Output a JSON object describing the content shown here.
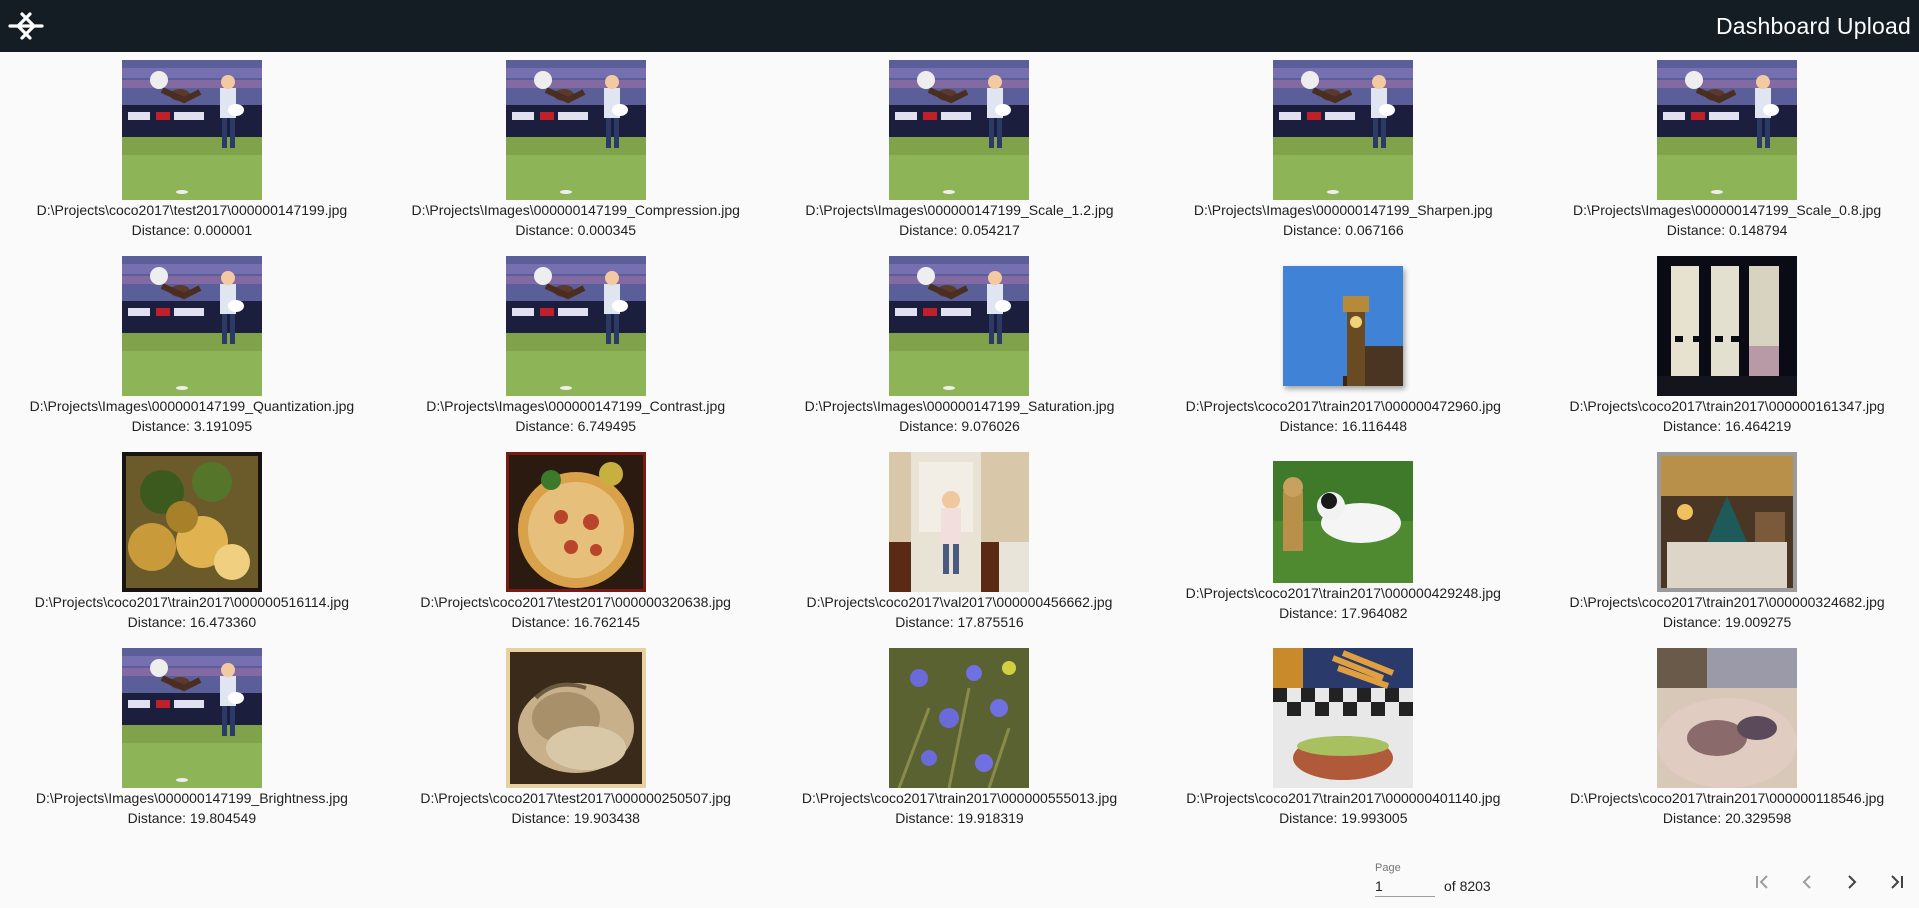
{
  "header": {
    "title": "Dashboard Upload",
    "logo_icon": "logo-icon"
  },
  "results": [
    {
      "path": "D:\\Projects\\coco2017\\test2017\\000000147199.jpg",
      "distance": "Distance: 0.000001",
      "thumb": "frisbee"
    },
    {
      "path": "D:\\Projects\\Images\\000000147199_Compression.jpg",
      "distance": "Distance: 0.000345",
      "thumb": "frisbee"
    },
    {
      "path": "D:\\Projects\\Images\\000000147199_Scale_1.2.jpg",
      "distance": "Distance: 0.054217",
      "thumb": "frisbee"
    },
    {
      "path": "D:\\Projects\\Images\\000000147199_Sharpen.jpg",
      "distance": "Distance: 0.067166",
      "thumb": "frisbee"
    },
    {
      "path": "D:\\Projects\\Images\\000000147199_Scale_0.8.jpg",
      "distance": "Distance: 0.148794",
      "thumb": "frisbee"
    },
    {
      "path": "D:\\Projects\\Images\\000000147199_Quantization.jpg",
      "distance": "Distance: 3.191095",
      "thumb": "frisbee"
    },
    {
      "path": "D:\\Projects\\Images\\000000147199_Contrast.jpg",
      "distance": "Distance: 6.749495",
      "thumb": "frisbee"
    },
    {
      "path": "D:\\Projects\\Images\\000000147199_Saturation.jpg",
      "distance": "Distance: 9.076026",
      "thumb": "frisbee"
    },
    {
      "path": "D:\\Projects\\coco2017\\train2017\\000000472960.jpg",
      "distance": "Distance: 16.116448",
      "thumb": "clocktower"
    },
    {
      "path": "D:\\Projects\\coco2017\\train2017\\000000161347.jpg",
      "distance": "Distance: 16.464219",
      "thumb": "window"
    },
    {
      "path": "D:\\Projects\\coco2017\\train2017\\000000516114.jpg",
      "distance": "Distance: 16.473360",
      "thumb": "salad"
    },
    {
      "path": "D:\\Projects\\coco2017\\test2017\\000000320638.jpg",
      "distance": "Distance: 16.762145",
      "thumb": "pizza"
    },
    {
      "path": "D:\\Projects\\coco2017\\val2017\\000000456662.jpg",
      "distance": "Distance: 17.875516",
      "thumb": "girl"
    },
    {
      "path": "D:\\Projects\\coco2017\\train2017\\000000429248.jpg",
      "distance": "Distance: 17.964082",
      "thumb": "dogs"
    },
    {
      "path": "D:\\Projects\\coco2017\\train2017\\000000324682.jpg",
      "distance": "Distance: 19.009275",
      "thumb": "room"
    },
    {
      "path": "D:\\Projects\\Images\\000000147199_Brightness.jpg",
      "distance": "Distance: 19.804549",
      "thumb": "frisbee"
    },
    {
      "path": "D:\\Projects\\coco2017\\test2017\\000000250507.jpg",
      "distance": "Distance: 19.903438",
      "thumb": "cat"
    },
    {
      "path": "D:\\Projects\\coco2017\\train2017\\000000555013.jpg",
      "distance": "Distance: 19.918319",
      "thumb": "flowers"
    },
    {
      "path": "D:\\Projects\\coco2017\\train2017\\000000401140.jpg",
      "distance": "Distance: 19.993005",
      "thumb": "burger"
    },
    {
      "path": "D:\\Projects\\coco2017\\train2017\\000000118546.jpg",
      "distance": "Distance: 20.329598",
      "thumb": "bed"
    }
  ],
  "paginator": {
    "page_label": "Page",
    "page_value": "1",
    "of_label": "of 8203",
    "first_icon": "first-page-icon",
    "prev_icon": "chevron-left-icon",
    "next_icon": "chevron-right-icon",
    "last_icon": "last-page-icon"
  }
}
